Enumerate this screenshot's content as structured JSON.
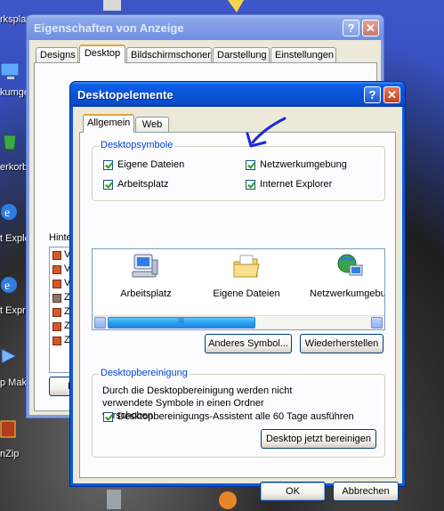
{
  "desktop": {
    "labels": [
      "rksplat",
      "kumge",
      "erkorb",
      "t Explo",
      "t Expro",
      "p Mak",
      "nZip"
    ]
  },
  "back_window": {
    "title": "Eigenschaften von Anzeige",
    "tabs": [
      "Designs",
      "Desktop",
      "Bildschirmschoner",
      "Darstellung",
      "Einstellungen"
    ],
    "active_tab": "Desktop",
    "background_label": "Hinter",
    "list_rows": [
      "V",
      "V",
      "V",
      "Z",
      "Z",
      "Z",
      "Z"
    ],
    "button_label": "D"
  },
  "dialog": {
    "title": "Desktopelemente",
    "help_glyph": "?",
    "close_glyph": "✕",
    "tabs": [
      "Allgemein",
      "Web"
    ],
    "active_tab": "Allgemein",
    "desktop_icons_group": {
      "label": "Desktopsymbole",
      "checkboxes": [
        {
          "label": "Eigene Dateien",
          "checked": true
        },
        {
          "label": "Netzwerkumgebung",
          "checked": true
        },
        {
          "label": "Arbeitsplatz",
          "checked": true
        },
        {
          "label": "Internet Explorer",
          "checked": true
        }
      ]
    },
    "icon_list": {
      "items": [
        {
          "label": "Arbeitsplatz",
          "icon": "computer-icon"
        },
        {
          "label": "Eigene Dateien",
          "icon": "documents-folder-icon"
        },
        {
          "label": "Netzwerkumgebun",
          "icon": "network-icon"
        }
      ],
      "scroll_thumb_grip": "III"
    },
    "change_icon_button": "Anderes Symbol...",
    "restore_button": "Wiederherstellen",
    "cleanup_group": {
      "label": "Desktopbereinigung",
      "description": "Durch die Desktopbereinigung werden nicht verwendete Symbole in einen Ordner verschoben.",
      "checkbox": {
        "label": "Desktopbereinigungs-Assistent alle 60 Tage ausführen",
        "checked": true
      },
      "button": "Desktop jetzt bereinigen"
    },
    "ok_button": "OK",
    "cancel_button": "Abbrechen"
  },
  "colors": {
    "xp_title_blue": "#0a5be0",
    "dialog_face": "#ece9d8",
    "group_label_blue": "#0046d5",
    "annotation_arrow": "#1a2ad8"
  }
}
